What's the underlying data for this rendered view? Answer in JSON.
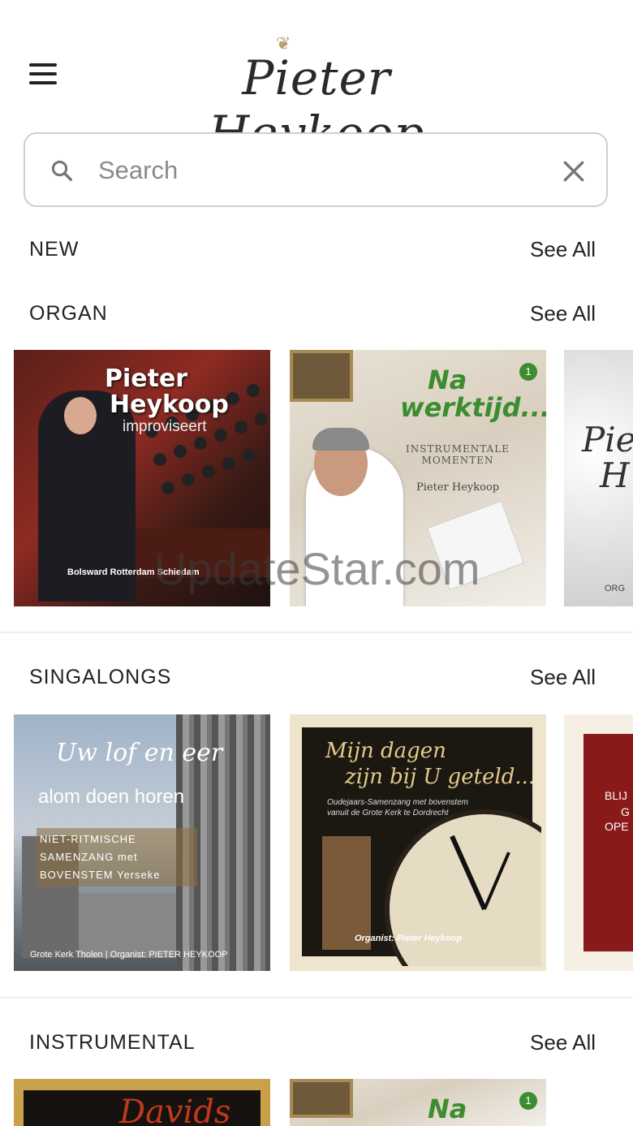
{
  "header": {
    "logo_text": "Pieter Heykoop",
    "logo_ornament": "❦"
  },
  "search": {
    "placeholder": "Search"
  },
  "sections": [
    {
      "title": "NEW",
      "see_all": "See All"
    },
    {
      "title": "ORGAN",
      "see_all": "See All"
    },
    {
      "title": "SINGALONGS",
      "see_all": "See All"
    },
    {
      "title": "INSTRUMENTAL",
      "see_all": "See All"
    }
  ],
  "organ_cards": [
    {
      "line1": "Pieter",
      "line2": "Heykoop",
      "line3": "improviseert",
      "footer": "Bolsward  Rotterdam  Schiedam"
    },
    {
      "line1": "Na",
      "line2": "werktijd...",
      "line3": "INSTRUMENTALE MOMENTEN",
      "footer": "Pieter Heykoop",
      "badge": "1"
    },
    {
      "line1": "Pie",
      "line2": "H",
      "footer": "ORG"
    }
  ],
  "singalong_cards": [
    {
      "line1": "Uw lof en eer",
      "line2": "alom doen horen",
      "line3": "NIET-RITMISCHE SAMENZANG met BOVENSTEM Yerseke",
      "footer": "Grote Kerk Tholen | Organist: PIETER HEYKOOP"
    },
    {
      "line1": "Mijn dagen",
      "line2": "zijn bij U geteld...",
      "line3": "Oudejaars-Samenzang met bovenstem vanuit de Grote Kerk te Dordrecht",
      "footer": "Organist: Pieter Heykoop"
    },
    {
      "line1": "BLIJ",
      "line2": "G",
      "line3": "OPE"
    }
  ],
  "instrumental_cards": [
    {
      "line1": "Davids"
    },
    {
      "line1": "Na",
      "badge": "1"
    }
  ],
  "watermark": "UpdateStar.com",
  "colors": {
    "accent_green": "#3c8d2f",
    "text": "#222222",
    "border": "#cfcfcf"
  }
}
